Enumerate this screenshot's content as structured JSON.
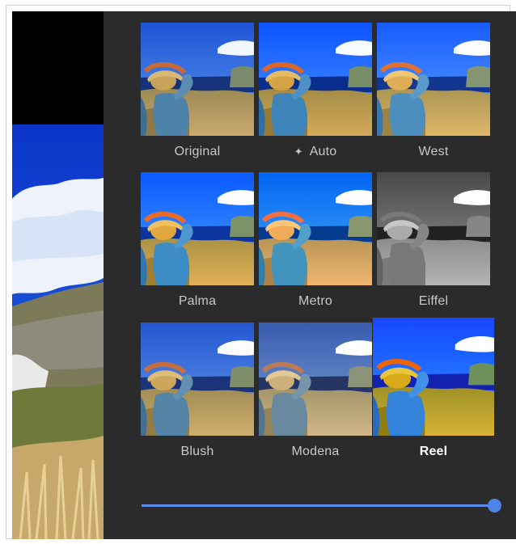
{
  "filters": [
    {
      "label": "Original",
      "icon": null
    },
    {
      "label": "Auto",
      "icon": "auto-sparkle-icon"
    },
    {
      "label": "West",
      "icon": null
    },
    {
      "label": "Palma",
      "icon": null
    },
    {
      "label": "Metro",
      "icon": null
    },
    {
      "label": "Eiffel",
      "icon": null
    },
    {
      "label": "Blush",
      "icon": null
    },
    {
      "label": "Modena",
      "icon": null
    },
    {
      "label": "Reel",
      "icon": null
    }
  ],
  "selected_filter": "Reel",
  "intensity_slider": {
    "value": 1.0
  },
  "colors": {
    "panel_background": "#2b2b2b",
    "accent": "#4c84ea",
    "label_text": "#c8c8c8",
    "selected_label_text": "#ffffff"
  }
}
